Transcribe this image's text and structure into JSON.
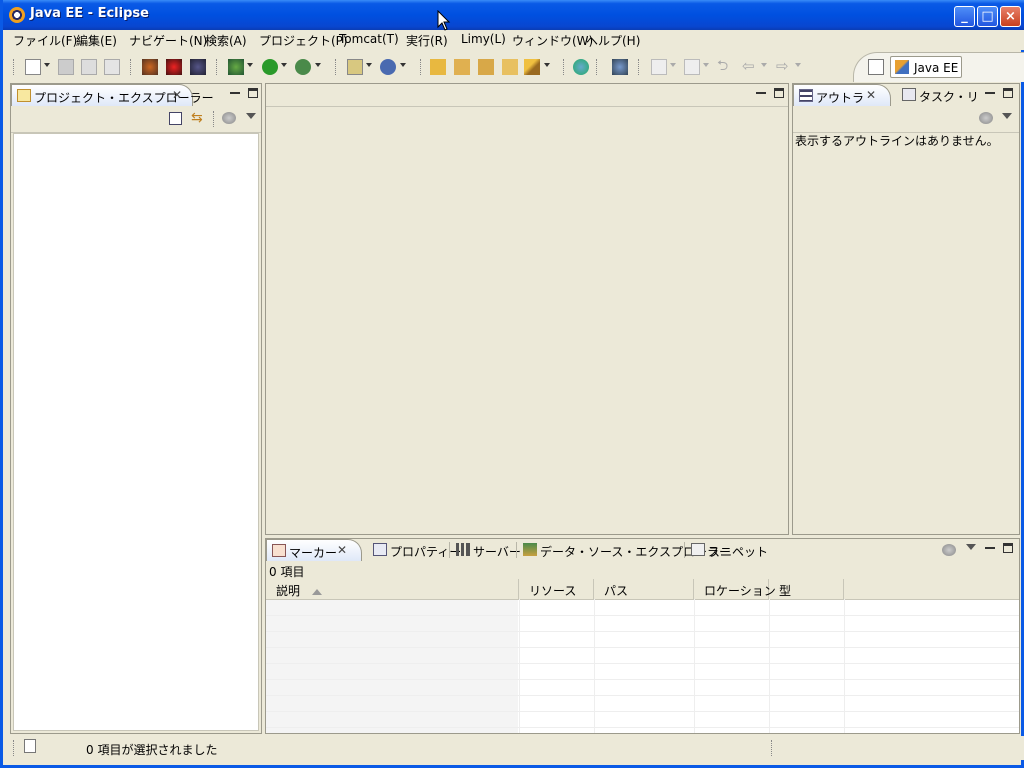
{
  "window": {
    "title": "Java EE - Eclipse",
    "minimize_label": "_",
    "maximize_label": "□",
    "close_label": "×"
  },
  "menu": [
    {
      "label": "ファイル(F)"
    },
    {
      "label": "編集(E)"
    },
    {
      "label": "ナビゲート(N)"
    },
    {
      "label": "検索(A)"
    },
    {
      "label": "プロジェクト(P)"
    },
    {
      "label": "Tomcat(T)"
    },
    {
      "label": "実行(R)"
    },
    {
      "label": "Limy(L)"
    },
    {
      "label": "ウィンドウ(W)"
    },
    {
      "label": "ヘルプ(H)"
    }
  ],
  "toolbar": {
    "icons": [
      "new-icon",
      "save-icon",
      "save-all-icon",
      "print-icon",
      "bug-tool-icon",
      "bug-remove-icon",
      "bug-refresh-icon",
      "debug-icon",
      "run-icon",
      "external-tools-icon",
      "new-server-icon",
      "new-service-icon",
      "open-folder-icon",
      "open-type-icon",
      "open-resource-icon",
      "open-task-icon",
      "pen-icon",
      "globe-icon",
      "search-icon",
      "next-annotation-icon",
      "prev-annotation-icon",
      "last-edit-icon",
      "back-icon",
      "forward-icon"
    ]
  },
  "perspective": {
    "open_icon": "open-perspective-icon",
    "label": "Java EE"
  },
  "project_explorer": {
    "tab_label": "プロジェクト・エクスプローラー",
    "close": "✕"
  },
  "outline": {
    "tab_label": "アウトラ",
    "close": "✕",
    "second_tab_label": "タスク・リ",
    "message": "表示するアウトラインはありません。"
  },
  "bottom": {
    "tabs": [
      {
        "label": "マーカー",
        "active": true
      },
      {
        "label": "プロパティー"
      },
      {
        "label": "サーバー"
      },
      {
        "label": "データ・ソース・エクスプローラー"
      },
      {
        "label": "スニペット"
      }
    ],
    "close": "✕",
    "count": "0 項目",
    "columns": [
      "説明",
      "リソース",
      "パス",
      "ロケーション",
      "型"
    ]
  },
  "status": {
    "text": "0 項目が選択されました"
  },
  "colors": {
    "titlebar": "#0050e0",
    "chrome": "#ece9d8",
    "active_tab": "#dfe8f8"
  }
}
